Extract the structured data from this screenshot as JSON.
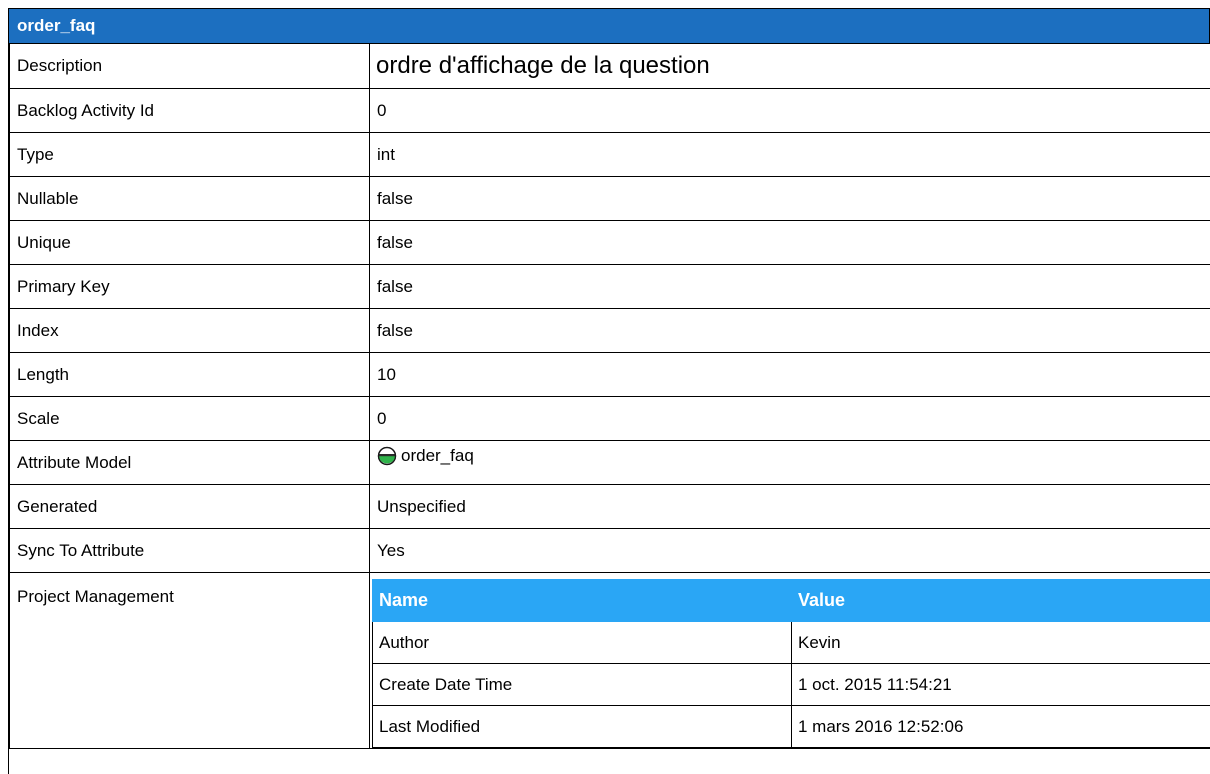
{
  "title": "order_faq",
  "rows": [
    {
      "key": "Description",
      "value": "ordre d'affichage de la question"
    },
    {
      "key": "Backlog Activity Id",
      "value": "0"
    },
    {
      "key": "Type",
      "value": "int"
    },
    {
      "key": "Nullable",
      "value": "false"
    },
    {
      "key": "Unique",
      "value": "false"
    },
    {
      "key": "Primary Key",
      "value": "false"
    },
    {
      "key": "Index",
      "value": "false"
    },
    {
      "key": "Length",
      "value": "10"
    },
    {
      "key": "Scale",
      "value": "0"
    },
    {
      "key": "Attribute Model",
      "value": "order_faq",
      "icon": "attribute-icon"
    },
    {
      "key": "Generated",
      "value": "Unspecified"
    },
    {
      "key": "Sync To Attribute",
      "value": "Yes"
    }
  ],
  "project_management": {
    "key": "Project Management",
    "headers": {
      "name": "Name",
      "value": "Value"
    },
    "rows": [
      {
        "name": "Author",
        "value": "Kevin"
      },
      {
        "name": "Create Date Time",
        "value": "1 oct. 2015 11:54:21"
      },
      {
        "name": "Last Modified",
        "value": "1 mars 2016 12:52:06"
      }
    ]
  },
  "colors": {
    "header": "#1c6fc0",
    "subheader": "#2aa6f5",
    "icon_green": "#2fb34a"
  }
}
